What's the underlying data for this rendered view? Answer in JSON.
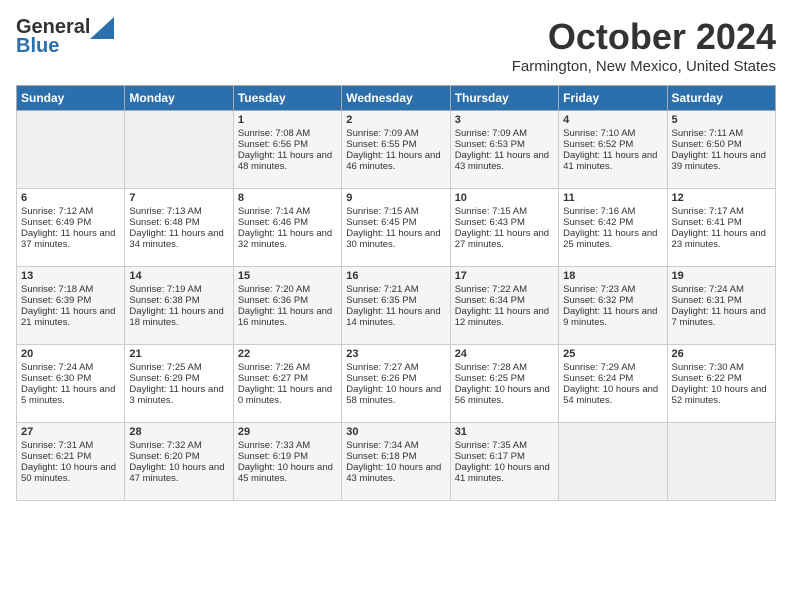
{
  "header": {
    "logo_general": "General",
    "logo_blue": "Blue",
    "month_title": "October 2024",
    "location": "Farmington, New Mexico, United States"
  },
  "days_of_week": [
    "Sunday",
    "Monday",
    "Tuesday",
    "Wednesday",
    "Thursday",
    "Friday",
    "Saturday"
  ],
  "weeks": [
    [
      {
        "day": "",
        "content": ""
      },
      {
        "day": "",
        "content": ""
      },
      {
        "day": "1",
        "content": "Sunrise: 7:08 AM\nSunset: 6:56 PM\nDaylight: 11 hours and 48 minutes."
      },
      {
        "day": "2",
        "content": "Sunrise: 7:09 AM\nSunset: 6:55 PM\nDaylight: 11 hours and 46 minutes."
      },
      {
        "day": "3",
        "content": "Sunrise: 7:09 AM\nSunset: 6:53 PM\nDaylight: 11 hours and 43 minutes."
      },
      {
        "day": "4",
        "content": "Sunrise: 7:10 AM\nSunset: 6:52 PM\nDaylight: 11 hours and 41 minutes."
      },
      {
        "day": "5",
        "content": "Sunrise: 7:11 AM\nSunset: 6:50 PM\nDaylight: 11 hours and 39 minutes."
      }
    ],
    [
      {
        "day": "6",
        "content": "Sunrise: 7:12 AM\nSunset: 6:49 PM\nDaylight: 11 hours and 37 minutes."
      },
      {
        "day": "7",
        "content": "Sunrise: 7:13 AM\nSunset: 6:48 PM\nDaylight: 11 hours and 34 minutes."
      },
      {
        "day": "8",
        "content": "Sunrise: 7:14 AM\nSunset: 6:46 PM\nDaylight: 11 hours and 32 minutes."
      },
      {
        "day": "9",
        "content": "Sunrise: 7:15 AM\nSunset: 6:45 PM\nDaylight: 11 hours and 30 minutes."
      },
      {
        "day": "10",
        "content": "Sunrise: 7:15 AM\nSunset: 6:43 PM\nDaylight: 11 hours and 27 minutes."
      },
      {
        "day": "11",
        "content": "Sunrise: 7:16 AM\nSunset: 6:42 PM\nDaylight: 11 hours and 25 minutes."
      },
      {
        "day": "12",
        "content": "Sunrise: 7:17 AM\nSunset: 6:41 PM\nDaylight: 11 hours and 23 minutes."
      }
    ],
    [
      {
        "day": "13",
        "content": "Sunrise: 7:18 AM\nSunset: 6:39 PM\nDaylight: 11 hours and 21 minutes."
      },
      {
        "day": "14",
        "content": "Sunrise: 7:19 AM\nSunset: 6:38 PM\nDaylight: 11 hours and 18 minutes."
      },
      {
        "day": "15",
        "content": "Sunrise: 7:20 AM\nSunset: 6:36 PM\nDaylight: 11 hours and 16 minutes."
      },
      {
        "day": "16",
        "content": "Sunrise: 7:21 AM\nSunset: 6:35 PM\nDaylight: 11 hours and 14 minutes."
      },
      {
        "day": "17",
        "content": "Sunrise: 7:22 AM\nSunset: 6:34 PM\nDaylight: 11 hours and 12 minutes."
      },
      {
        "day": "18",
        "content": "Sunrise: 7:23 AM\nSunset: 6:32 PM\nDaylight: 11 hours and 9 minutes."
      },
      {
        "day": "19",
        "content": "Sunrise: 7:24 AM\nSunset: 6:31 PM\nDaylight: 11 hours and 7 minutes."
      }
    ],
    [
      {
        "day": "20",
        "content": "Sunrise: 7:24 AM\nSunset: 6:30 PM\nDaylight: 11 hours and 5 minutes."
      },
      {
        "day": "21",
        "content": "Sunrise: 7:25 AM\nSunset: 6:29 PM\nDaylight: 11 hours and 3 minutes."
      },
      {
        "day": "22",
        "content": "Sunrise: 7:26 AM\nSunset: 6:27 PM\nDaylight: 11 hours and 0 minutes."
      },
      {
        "day": "23",
        "content": "Sunrise: 7:27 AM\nSunset: 6:26 PM\nDaylight: 10 hours and 58 minutes."
      },
      {
        "day": "24",
        "content": "Sunrise: 7:28 AM\nSunset: 6:25 PM\nDaylight: 10 hours and 56 minutes."
      },
      {
        "day": "25",
        "content": "Sunrise: 7:29 AM\nSunset: 6:24 PM\nDaylight: 10 hours and 54 minutes."
      },
      {
        "day": "26",
        "content": "Sunrise: 7:30 AM\nSunset: 6:22 PM\nDaylight: 10 hours and 52 minutes."
      }
    ],
    [
      {
        "day": "27",
        "content": "Sunrise: 7:31 AM\nSunset: 6:21 PM\nDaylight: 10 hours and 50 minutes."
      },
      {
        "day": "28",
        "content": "Sunrise: 7:32 AM\nSunset: 6:20 PM\nDaylight: 10 hours and 47 minutes."
      },
      {
        "day": "29",
        "content": "Sunrise: 7:33 AM\nSunset: 6:19 PM\nDaylight: 10 hours and 45 minutes."
      },
      {
        "day": "30",
        "content": "Sunrise: 7:34 AM\nSunset: 6:18 PM\nDaylight: 10 hours and 43 minutes."
      },
      {
        "day": "31",
        "content": "Sunrise: 7:35 AM\nSunset: 6:17 PM\nDaylight: 10 hours and 41 minutes."
      },
      {
        "day": "",
        "content": ""
      },
      {
        "day": "",
        "content": ""
      }
    ]
  ]
}
